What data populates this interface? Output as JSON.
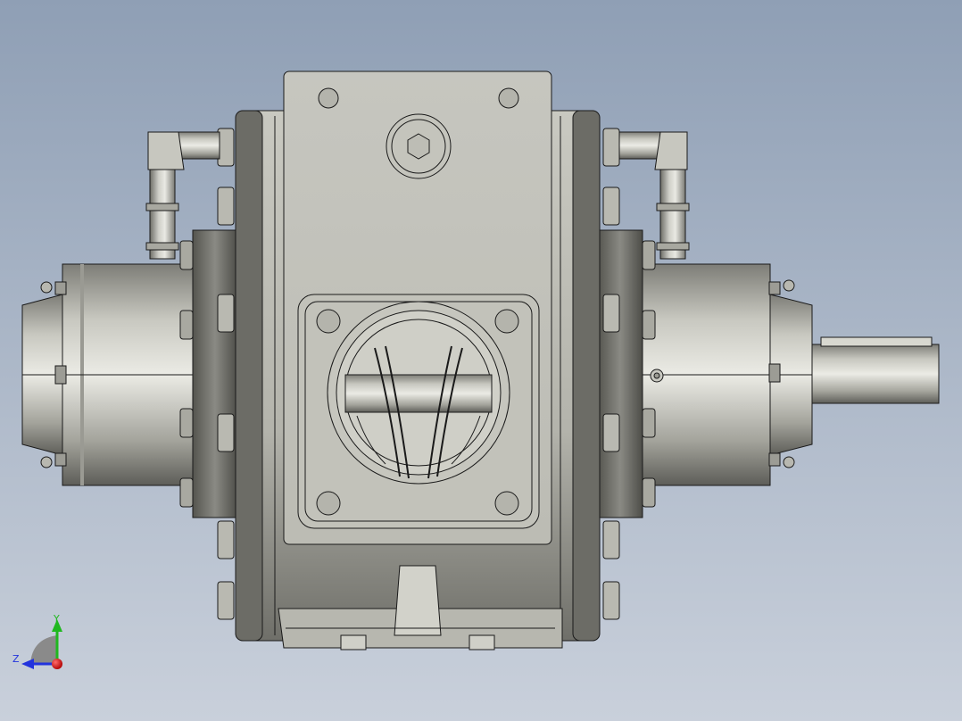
{
  "viewport": {
    "background_top": "#8f9fb5",
    "background_bottom": "#c9d0db"
  },
  "model": {
    "metal_light": "#e4e4de",
    "metal_mid": "#bdbdb5",
    "metal_dark": "#6b6b66",
    "edge": "#1a1a1a"
  },
  "triad": {
    "y_label": "Y",
    "z_label": "Z",
    "y_color": "#1fb81f",
    "z_color": "#2233dd",
    "x_color": "#e01010"
  }
}
